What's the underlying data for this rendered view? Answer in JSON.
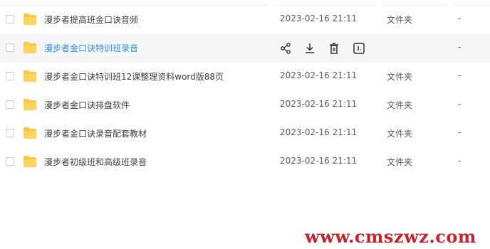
{
  "files": [
    {
      "name": "漫步者提高班金口诀音频",
      "date": "2023-02-16 21:11",
      "type": "文件夹",
      "size": "-"
    },
    {
      "name": "漫步者金口诀特训班录音",
      "date": "",
      "type": "",
      "size": "-",
      "hovered": true
    },
    {
      "name": "漫步者金口诀特训班12课整理资料word版88页",
      "date": "2023-02-16 21:11",
      "type": "文件夹",
      "size": "-"
    },
    {
      "name": "漫步者金口诀排盘软件",
      "date": "2023-02-16 21:11",
      "type": "文件夹",
      "size": "-"
    },
    {
      "name": "漫步者金口诀录音配套教材",
      "date": "2023-02-16 21:11",
      "type": "文件夹",
      "size": "-"
    },
    {
      "name": "漫步者初级班和高级班录音",
      "date": "2023-02-16 21:11",
      "type": "文件夹",
      "size": "-"
    }
  ],
  "row_actions": [
    "share-icon",
    "download-icon",
    "delete-icon",
    "more-icon"
  ],
  "watermark": "www.cmszwz.com",
  "colors": {
    "folder": "#ffc83d",
    "hover_bg": "#f5f6f8",
    "hover_text": "#2f8ff5",
    "watermark": "#c8232c"
  }
}
